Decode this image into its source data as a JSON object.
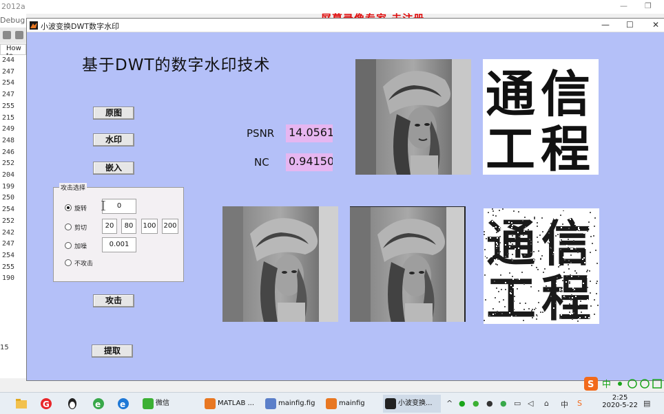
{
  "bg_window": {
    "title": "2012a",
    "menu_label": "Debug",
    "tab_label": "How to",
    "list_values": [
      "244",
      "247",
      "254",
      "247",
      "255",
      "215",
      "249",
      "248",
      "246",
      "252",
      "204",
      "199",
      "250",
      "254",
      "252",
      "242",
      "247",
      "254",
      "255",
      "190"
    ],
    "status_value": "15"
  },
  "overlay_watermark": "屏幕录像专家  未注册",
  "figure": {
    "window_title": "小波变换DWT数字水印",
    "main_title": "基于DWT的数字水印技术",
    "buttons": {
      "original": "原图",
      "watermark": "水印",
      "embed": "嵌入",
      "attack": "攻击",
      "extract": "提取"
    },
    "psnr_label": "PSNR",
    "psnr_value": "14.0561",
    "nc_label": "NC",
    "nc_value": "0.94150",
    "attack_panel": {
      "title": "攻击选择",
      "options": [
        {
          "label": "旋转",
          "selected": true
        },
        {
          "label": "剪切",
          "selected": false
        },
        {
          "label": "加噪",
          "selected": false
        },
        {
          "label": "不攻击",
          "selected": false
        }
      ],
      "rotate_value": "0",
      "crop_values": [
        "20",
        "80",
        "100",
        "200"
      ],
      "noise_value": "0.001"
    },
    "watermark_chars_top": [
      "通",
      "信",
      "工",
      "程"
    ],
    "watermark_chars_extracted": [
      "通",
      "信",
      "工",
      "程"
    ]
  },
  "taskbar": {
    "apps": [
      {
        "label": "微信",
        "icon": "wechat-icon"
      },
      {
        "label": "MATLAB ...",
        "icon": "matlab-icon"
      },
      {
        "label": "mainfig.fig",
        "icon": "fig-file-icon"
      },
      {
        "label": "mainfig",
        "icon": "matlab-icon"
      },
      {
        "label": "小波变换...",
        "icon": "matlab-icon"
      }
    ],
    "time": "2:25",
    "date": "2020-5-22",
    "ime_label": "中"
  }
}
